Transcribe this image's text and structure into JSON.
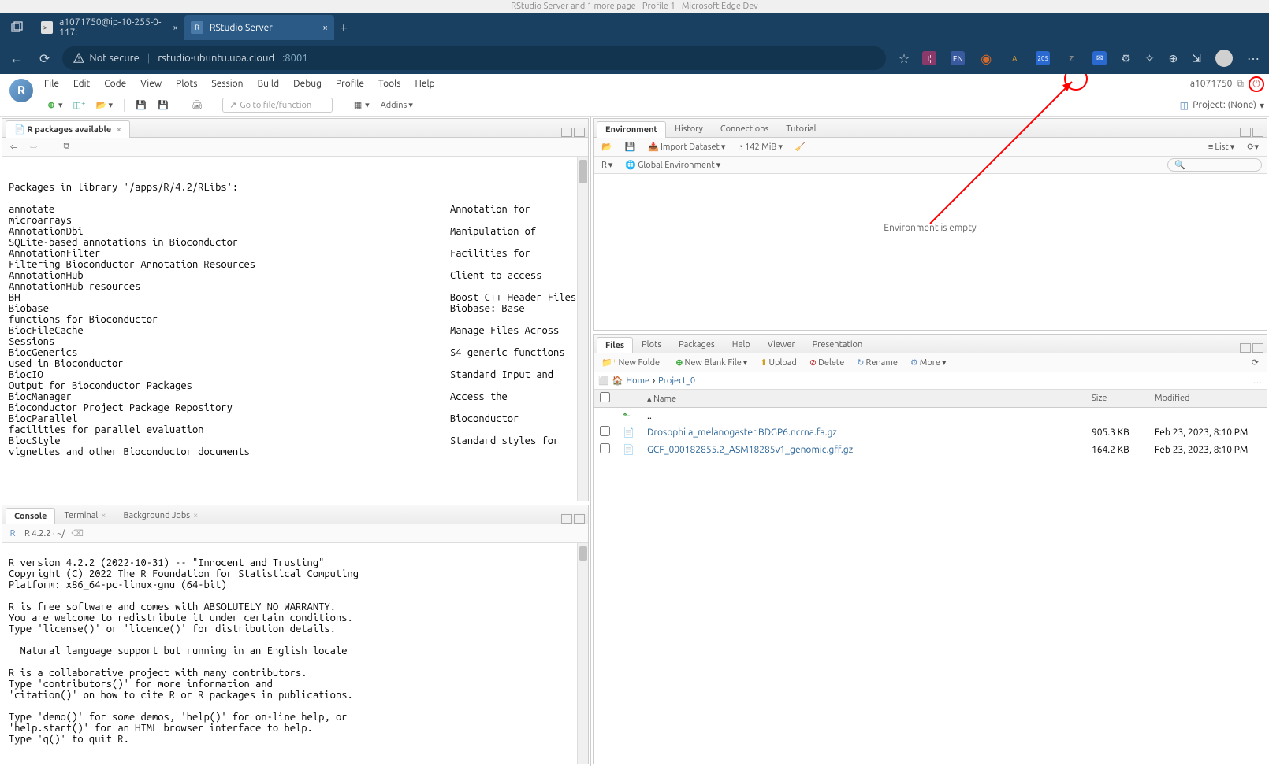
{
  "window_title": "RStudio Server and 1 more page - Profile 1 - Microsoft Edge Dev",
  "browser": {
    "tab1": "a1071750@ip-10-255-0-117:",
    "tab2": "RStudio Server",
    "url_secure_label": "Not secure",
    "url_host": "rstudio-ubuntu.uoa.cloud",
    "url_port": ":8001",
    "ext_badge": "205"
  },
  "menubar": {
    "file": "File",
    "edit": "Edit",
    "code": "Code",
    "view": "View",
    "plots": "Plots",
    "session": "Session",
    "build": "Build",
    "debug": "Debug",
    "profile": "Profile",
    "tools": "Tools",
    "help": "Help",
    "user": "a1071750",
    "project": "Project: (None)"
  },
  "toolbar": {
    "gotofile": "Go to file/function",
    "addins": "Addins"
  },
  "source": {
    "tab_title": "R packages available",
    "text_left": "Packages in library '/apps/R/4.2/RLibs':\n\nannotate\nmicroarrays\nAnnotationDbi\nSQLite-based annotations in Bioconductor\nAnnotationFilter\nFiltering Bioconductor Annotation Resources\nAnnotationHub\nAnnotationHub resources\nBH\nBiobase\nfunctions for Bioconductor\nBiocFileCache\nSessions\nBiocGenerics\nused in Bioconductor\nBiocIO\nOutput for Bioconductor Packages\nBiocManager\nBioconductor Project Package Repository\nBiocParallel\nfacilities for parallel evaluation\nBiocStyle\nvignettes and other Bioconductor documents",
    "text_right": "\n\nAnnotation for\n\nManipulation of\n\nFacilities for\n\nClient to access\n\nBoost C++ Header Files\nBiobase: Base\n\nManage Files Across\n\nS4 generic functions\n\nStandard Input and\n\nAccess the\n\nBioconductor\n\nStandard styles for"
  },
  "console": {
    "tab_console": "Console",
    "tab_terminal": "Terminal",
    "tab_bgjobs": "Background Jobs",
    "version": "R 4.2.2 · ~/",
    "text": "R version 4.2.2 (2022-10-31) -- \"Innocent and Trusting\"\nCopyright (C) 2022 The R Foundation for Statistical Computing\nPlatform: x86_64-pc-linux-gnu (64-bit)\n\nR is free software and comes with ABSOLUTELY NO WARRANTY.\nYou are welcome to redistribute it under certain conditions.\nType 'license()' or 'licence()' for distribution details.\n\n  Natural language support but running in an English locale\n\nR is a collaborative project with many contributors.\nType 'contributors()' for more information and\n'citation()' on how to cite R or R packages in publications.\n\nType 'demo()' for some demos, 'help()' for on-line help, or\n'help.start()' for an HTML browser interface to help.\nType 'q()' to quit R.\n"
  },
  "env": {
    "tab_environment": "Environment",
    "tab_history": "History",
    "tab_connections": "Connections",
    "tab_tutorial": "Tutorial",
    "import_label": "Import Dataset",
    "memory": "142 MiB",
    "r_label": "R",
    "scope": "Global Environment",
    "list_label": "List",
    "empty_msg": "Environment is empty"
  },
  "files": {
    "tab_files": "Files",
    "tab_plots": "Plots",
    "tab_packages": "Packages",
    "tab_help": "Help",
    "tab_viewer": "Viewer",
    "tab_presentation": "Presentation",
    "new_folder": "New Folder",
    "new_blank": "New Blank File",
    "upload": "Upload",
    "delete": "Delete",
    "rename": "Rename",
    "more": "More",
    "bc_home": "Home",
    "bc_project": "Project_0",
    "col_name": "Name",
    "col_size": "Size",
    "col_modified": "Modified",
    "up_dir": "..",
    "file1_name": "Drosophila_melanogaster.BDGP6.ncrna.fa.gz",
    "file1_size": "905.3 KB",
    "file1_date": "Feb 23, 2023, 8:10 PM",
    "file2_name": "GCF_000182855.2_ASM18285v1_genomic.gff.gz",
    "file2_size": "164.2 KB",
    "file2_date": "Feb 23, 2023, 8:10 PM"
  }
}
